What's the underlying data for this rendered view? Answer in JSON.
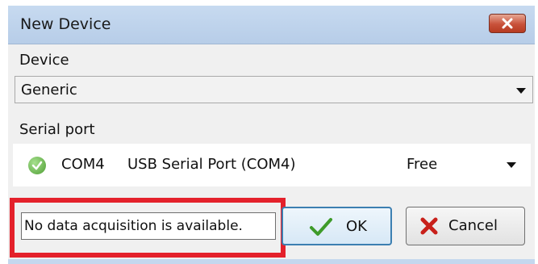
{
  "window": {
    "title": "New Device",
    "close_icon": "close-icon"
  },
  "device": {
    "label": "Device",
    "selected": "Generic"
  },
  "serial_port": {
    "label": "Serial port",
    "status_icon": "check-circle-icon",
    "port": "COM4",
    "description": "USB Serial Port (COM4)",
    "availability": "Free"
  },
  "status": {
    "message": "No data acquisition is available.",
    "highlight_color": "#e4212b"
  },
  "buttons": {
    "ok_label": "OK",
    "ok_icon": "checkmark-icon",
    "cancel_label": "Cancel",
    "cancel_icon": "x-icon"
  }
}
